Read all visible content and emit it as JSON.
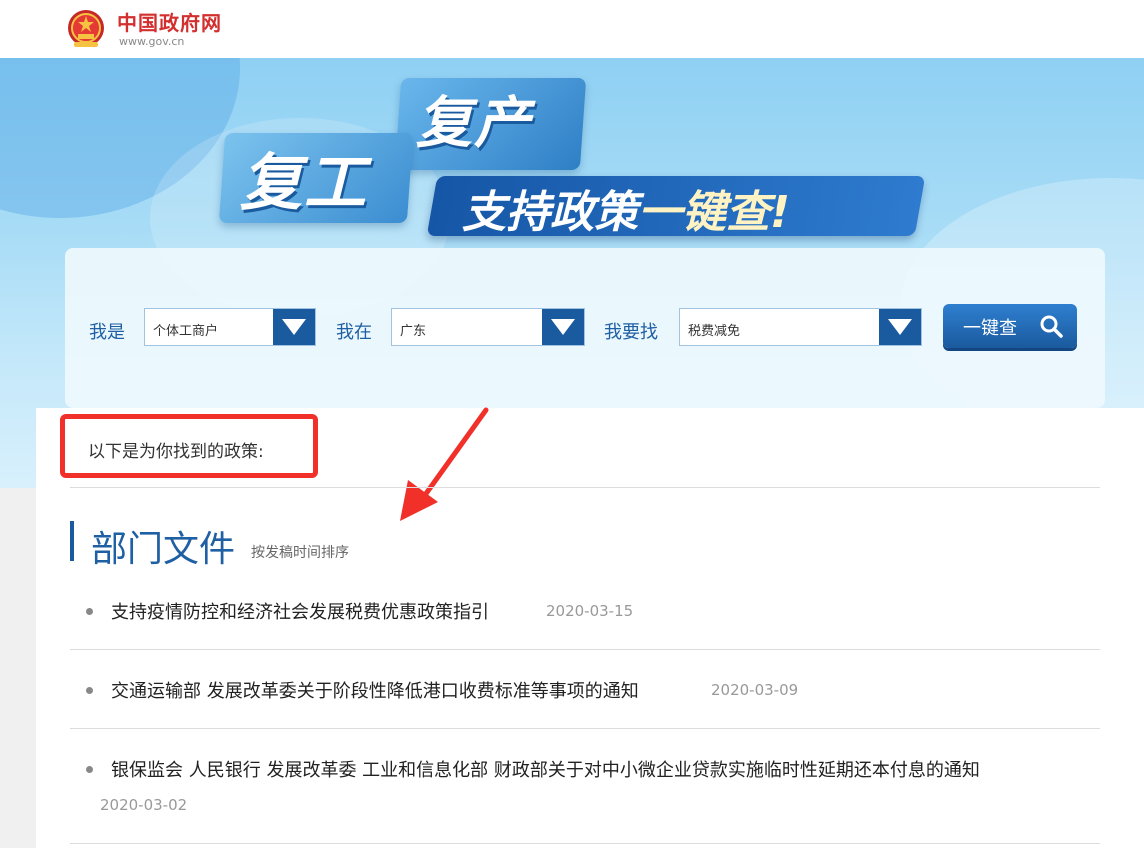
{
  "header": {
    "site_name": "中国政府网",
    "site_url": "www.gov.cn",
    "emblem_icon": "national-emblem-icon"
  },
  "banner": {
    "word_fuchan": "复产",
    "word_fugong": "复工",
    "slogan_main": "支持政策",
    "slogan_accent": "一键查!"
  },
  "search": {
    "role_label": "我是",
    "role_value": "个体工商户",
    "location_label": "我在",
    "location_value": "广东",
    "need_label": "我要找",
    "need_value": "税费减免",
    "button_label": "一键查",
    "button_icon": "search-icon",
    "accent_color": "#1a5a9e"
  },
  "results": {
    "message": "以下是为你找到的政策:",
    "annotation_color": "#f2302a"
  },
  "section": {
    "title": "部门文件",
    "sort_note": "按发稿时间排序",
    "items": [
      {
        "title": "支持疫情防控和经济社会发展税费优惠政策指引",
        "date": "2020-03-15"
      },
      {
        "title": "交通运输部 发展改革委关于阶段性降低港口收费标准等事项的通知",
        "date": "2020-03-09"
      },
      {
        "title": "银保监会 人民银行 发展改革委 工业和信息化部 财政部关于对中小微企业贷款实施临时性延期还本付息的通知",
        "date": "2020-03-02"
      }
    ]
  }
}
